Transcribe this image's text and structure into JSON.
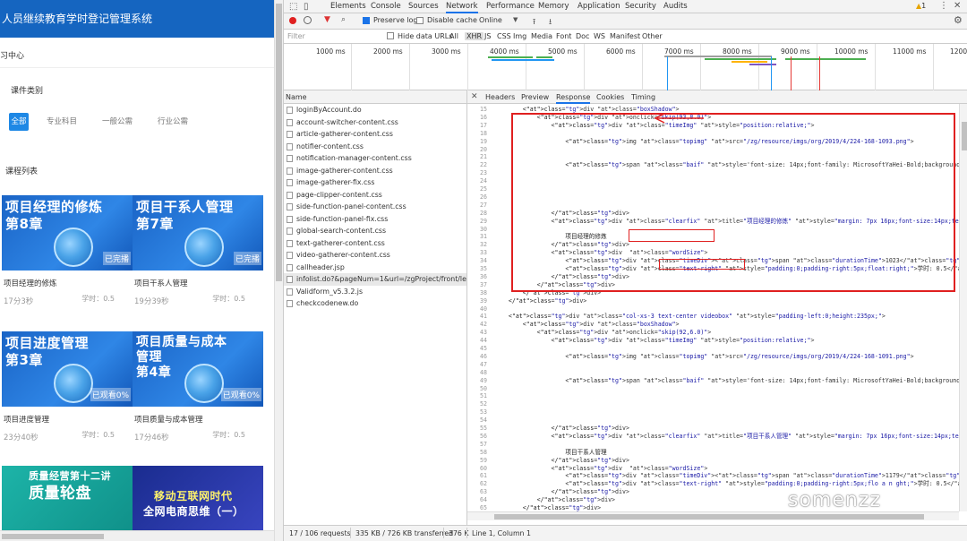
{
  "left": {
    "header_title": "人员继续教育学时登记管理系统",
    "subtitle": "习中心",
    "category_label": "课件类别",
    "filters": [
      "全部",
      "专业科目",
      "一般公需",
      "行业公需"
    ],
    "list_title": "课程列表",
    "cards": [
      {
        "thumb_title": [
          "项目经理的修炼",
          "第8章"
        ],
        "badge": "已完播",
        "name": "项目经理的修炼",
        "duration": "17分3秒",
        "hours": "学时：0.5"
      },
      {
        "thumb_title": [
          "项目干系人管理",
          "第7章"
        ],
        "badge": "已完播",
        "name": "项目干系人管理",
        "duration": "19分39秒",
        "hours": "学时：0.5"
      },
      {
        "thumb_title": [
          "项目进度管理",
          "第3章"
        ],
        "badge": "已观看0%",
        "name": "项目进度管理",
        "duration": "23分40秒",
        "hours": "学时：0.5"
      },
      {
        "thumb_title": [
          "项目质量与成本",
          "管理",
          "第4章"
        ],
        "badge": "已观看0%",
        "name": "项目质量与成本管理",
        "duration": "17分46秒",
        "hours": "学时：0.5"
      },
      {
        "thumb_title": [
          "质量经营第十二讲",
          "质量轮盘"
        ],
        "badge": "",
        "name": "",
        "duration": "",
        "hours": ""
      },
      {
        "thumb_title": [
          "移动互联网时代",
          "全网电商思维（一）"
        ],
        "badge": "",
        "name": "",
        "duration": "",
        "hours": ""
      }
    ]
  },
  "devtools": {
    "tabs": [
      "Elements",
      "Console",
      "Sources",
      "Network",
      "Performance",
      "Memory",
      "Application",
      "Security",
      "Audits"
    ],
    "active_tab": "Network",
    "warning_count": "1",
    "toolbar": {
      "preserve_log": "Preserve log",
      "disable_cache": "Disable cache",
      "throttle": "Online"
    },
    "filter_placeholder": "Filter",
    "hide_data_urls": "Hide data URLs",
    "filter_types": [
      "All",
      "XHR",
      "JS",
      "CSS",
      "Img",
      "Media",
      "Font",
      "Doc",
      "WS",
      "Manifest",
      "Other"
    ],
    "timeline_ticks": [
      "1000 ms",
      "2000 ms",
      "3000 ms",
      "4000 ms",
      "5000 ms",
      "6000 ms",
      "7000 ms",
      "8000 ms",
      "9000 ms",
      "10000 ms",
      "11000 ms",
      "1200"
    ],
    "name_header": "Name",
    "requests": [
      "loginByAccount.do",
      "account-switcher-content.css",
      "article-gatherer-content.css",
      "notifier-content.css",
      "notification-manager-content.css",
      "image-gatherer-content.css",
      "image-gatherer-fix.css",
      "page-clipper-content.css",
      "side-function-panel-content.css",
      "side-function-panel-fix.css",
      "global-search-content.css",
      "text-gatherer-content.css",
      "video-gatherer-content.css",
      "callheader.jsp",
      "infolist.do?&pageNum=1&url=/zgProject/front/lear...",
      "Validform_v5.3.2.js",
      "checkcodenew.do"
    ],
    "selected_request": 14,
    "detail_tabs": [
      "Headers",
      "Preview",
      "Response",
      "Cookies",
      "Timing"
    ],
    "active_detail_tab": "Response",
    "code_lines": [
      {
        "n": "15",
        "t": "        <div class=\"boxShadow\">"
      },
      {
        "n": "16",
        "t": "            <div onclick=\"skip(93,8.0)\">"
      },
      {
        "n": "17",
        "t": "                <div class=\"timeImg\" style=\"position:relative;\">"
      },
      {
        "n": "18",
        "t": ""
      },
      {
        "n": "19",
        "t": "                    <img class=\"topimg\" src=\"/zg/resource/imgs/org/2019/4/224-168-1093.png\">"
      },
      {
        "n": "20",
        "t": ""
      },
      {
        "n": "21",
        "t": ""
      },
      {
        "n": "22",
        "t": "                    <span class=\"baif\" style='font-size: 14px;font-family: MicrosoftYaHei-Bold;background: #ccc;padding: 2px"
      },
      {
        "n": "23",
        "t": ""
      },
      {
        "n": "24",
        "t": ""
      },
      {
        "n": "25",
        "t": ""
      },
      {
        "n": "26",
        "t": ""
      },
      {
        "n": "27",
        "t": ""
      },
      {
        "n": "28",
        "t": "                </div>"
      },
      {
        "n": "29",
        "t": "                <div class=\"clearfix\" title=\"项目经理的修炼\" style=\"margin: 7px 16px;font-size:14px;text-align: left;\">"
      },
      {
        "n": "30",
        "t": ""
      },
      {
        "n": "31",
        "t": "                    项目经理的修炼"
      },
      {
        "n": "32",
        "t": "                </div>"
      },
      {
        "n": "33",
        "t": "                <div  class=\"wordSize\">"
      },
      {
        "n": "34",
        "t": "                    <div class=\"timeDiv\"><span class=\"durationTime\">1023</span></div>"
      },
      {
        "n": "35",
        "t": "                    <div class=\"text-right\" style=\"padding:0;padding-right:5px;float:right;\">学时: 0.5</div>"
      },
      {
        "n": "36",
        "t": "                </div>"
      },
      {
        "n": "37",
        "t": "            </div>"
      },
      {
        "n": "38",
        "t": "        </div>"
      },
      {
        "n": "39",
        "t": "    </div>"
      },
      {
        "n": "40",
        "t": ""
      },
      {
        "n": "41",
        "t": "    <div class=\"col-xs-3 text-center videobox\" style=\"padding-left:0;height:235px;\">"
      },
      {
        "n": "42",
        "t": "        <div class=\"boxShadow\">"
      },
      {
        "n": "43",
        "t": "            <div onclick=\"skip(92,6.0)\">"
      },
      {
        "n": "44",
        "t": "                <div class=\"timeImg\" style=\"position:relative;\">"
      },
      {
        "n": "45",
        "t": ""
      },
      {
        "n": "46",
        "t": "                    <img class=\"topimg\" src=\"/zg/resource/imgs/org/2019/4/224-168-1091.png\">"
      },
      {
        "n": "47",
        "t": ""
      },
      {
        "n": "48",
        "t": ""
      },
      {
        "n": "49",
        "t": "                    <span class=\"baif\" style='font-size: 14px;font-family: MicrosoftYaHei-Bold;background: #ccc;padding: 2px"
      },
      {
        "n": "50",
        "t": ""
      },
      {
        "n": "51",
        "t": ""
      },
      {
        "n": "52",
        "t": ""
      },
      {
        "n": "53",
        "t": ""
      },
      {
        "n": "54",
        "t": ""
      },
      {
        "n": "55",
        "t": "                </div>"
      },
      {
        "n": "56",
        "t": "                <div class=\"clearfix\" title=\"项目干系人管理\" style=\"margin: 7px 16px;font-size:14px;text-align: left;\">"
      },
      {
        "n": "57",
        "t": ""
      },
      {
        "n": "58",
        "t": "                    项目干系人管理"
      },
      {
        "n": "59",
        "t": "                </div>"
      },
      {
        "n": "60",
        "t": "                <div  class=\"wordSize\">"
      },
      {
        "n": "61",
        "t": "                    <div class=\"timeDiv\"><span class=\"durationTime\">1179</span></div>"
      },
      {
        "n": "62",
        "t": "                    <div class=\"text-right\" style=\"padding:0;padding-right:5px;flo a n ght;\">学时: 0.5</div>"
      },
      {
        "n": "63",
        "t": "                </div>"
      },
      {
        "n": "64",
        "t": "            </div>"
      },
      {
        "n": "65",
        "t": "        </div>"
      }
    ],
    "status": [
      "17 / 106 requests",
      "335 KB / 726 KB transferred",
      "376 K",
      "Line 1, Column 1"
    ]
  },
  "watermark": "somenzz",
  "colors": {
    "brand_blue": "#1565c0",
    "annotation_red": "#e02020",
    "devtools_active": "#1a73e8"
  }
}
